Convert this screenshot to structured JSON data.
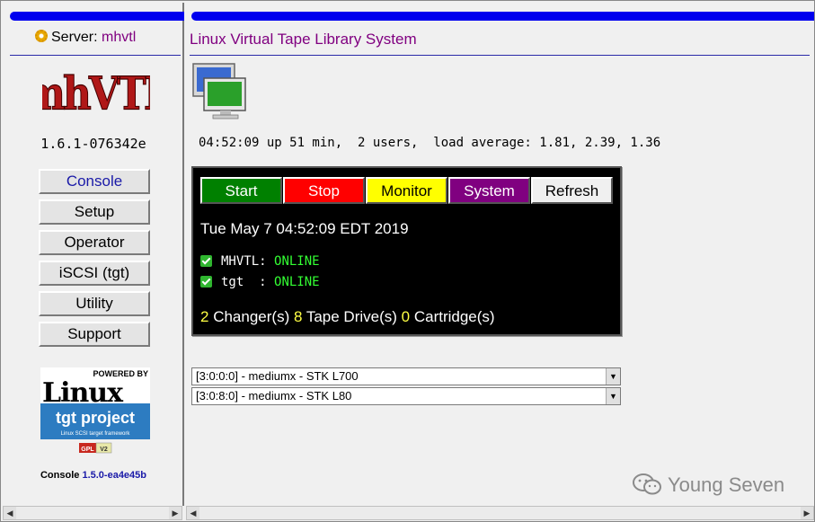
{
  "left": {
    "server_label": "Server:",
    "server_name": "mhvtl",
    "logo_text": "mhVTL",
    "version": "1.6.1-076342e",
    "nav": [
      "Console",
      "Setup",
      "Operator",
      "iSCSI (tgt)",
      "Utility",
      "Support"
    ],
    "badge": {
      "powered_by": "POWERED BY",
      "linux": "Linux",
      "tgt_project": "tgt project",
      "tgt_sub": "Linux SCSI target framework",
      "gpl": "GPL",
      "gpl_ver": "V2"
    },
    "console_label": "Console",
    "console_version": "1.5.0-ea4e45b"
  },
  "right": {
    "title": "Linux Virtual Tape Library System",
    "uptime": "04:52:09 up 51 min,  2 users,  load average: 1.81, 2.39, 1.36",
    "buttons": {
      "start": "Start",
      "stop": "Stop",
      "monitor": "Monitor",
      "system": "System",
      "refresh": "Refresh"
    },
    "datetime": "Tue May 7 04:52:09 EDT 2019",
    "services": [
      {
        "name": "MHVTL:",
        "state": "ONLINE"
      },
      {
        "name": "tgt  :",
        "state": "ONLINE"
      }
    ],
    "counts": {
      "changers": "2",
      "changers_label": " Changer(s) ",
      "drives": "8",
      "drives_label": " Tape Drive(s) ",
      "cartridges": "0",
      "cartridges_label": " Cartridge(s)"
    },
    "libraries": [
      "[3:0:0:0] - mediumx - STK L700",
      "[3:0:8:0] - mediumx - STK L80"
    ]
  },
  "watermark": "Young Seven",
  "colors": {
    "accent_blue": "#0000ee",
    "title_purple": "#800080",
    "online_green": "#33ff33",
    "count_yellow": "#ffff44"
  }
}
